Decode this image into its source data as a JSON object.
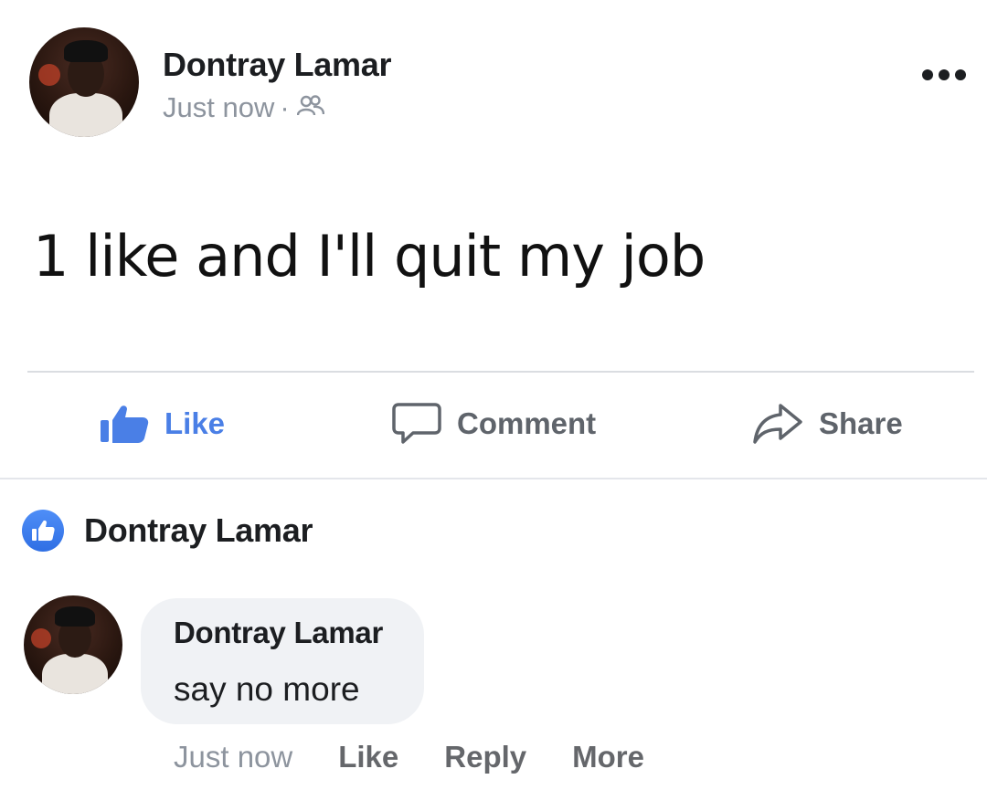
{
  "post": {
    "author": "Dontray Lamar",
    "timestamp": "Just now",
    "separator": "·",
    "audience_icon": "friends-icon",
    "menu_icon": "more-options-icon",
    "body": "1 like and I'll quit my job"
  },
  "actions": {
    "like_label": "Like",
    "comment_label": "Comment",
    "share_label": "Share",
    "like_color": "#4a7fe6",
    "muted_color": "#5f646b"
  },
  "reactions": {
    "liker_name": "Dontray Lamar",
    "icon": "thumbs-up-icon"
  },
  "comment": {
    "author": "Dontray Lamar",
    "text": "say no more",
    "timestamp": "Just now",
    "like_label": "Like",
    "reply_label": "Reply",
    "more_label": "More"
  }
}
